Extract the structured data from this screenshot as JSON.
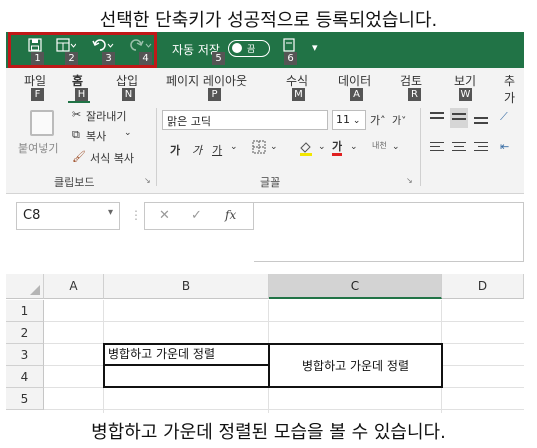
{
  "captions": {
    "top": "선택한 단축키가 성공적으로 등록되었습니다.",
    "bottom": "병합하고 가운데 정렬된 모습을 볼 수 있습니다."
  },
  "qat": {
    "keytips": [
      "1",
      "2",
      "3",
      "4",
      "5",
      "6"
    ],
    "autosave_label": "자동 저장",
    "toggle_label": "끔",
    "icons": [
      "save-icon",
      "merge-center-icon",
      "undo-icon",
      "redo-icon",
      "quick-print-icon",
      "customize-qat-icon"
    ]
  },
  "tabs": [
    {
      "label": "파일",
      "keytip": "F"
    },
    {
      "label": "홈",
      "keytip": "H"
    },
    {
      "label": "삽입",
      "keytip": "N"
    },
    {
      "label": "페이지 레이아웃",
      "keytip": "P"
    },
    {
      "label": "수식",
      "keytip": "M"
    },
    {
      "label": "데이터",
      "keytip": "A"
    },
    {
      "label": "검토",
      "keytip": "R"
    },
    {
      "label": "보기",
      "keytip": "W"
    },
    {
      "label": "추가"
    }
  ],
  "ribbon": {
    "clipboard": {
      "paste": "붙여넣기",
      "cut": "잘라내기",
      "copy": "복사",
      "format_painter": "서식 복사",
      "group_label": "클립보드"
    },
    "font": {
      "font_name": "맑은 고딕",
      "font_size": "11",
      "grow": "가˄",
      "shrink": "가˅",
      "bold": "가",
      "italic": "가",
      "underline": "가",
      "font_color": "가",
      "phonetic": "내천",
      "group_label": "글꼴"
    }
  },
  "formula_bar": {
    "name_box": "C8",
    "cancel": "✕",
    "enter": "✓",
    "fx": "fx",
    "content": ""
  },
  "sheet": {
    "columns": [
      "A",
      "B",
      "C",
      "D"
    ],
    "rows": [
      "1",
      "2",
      "3",
      "4",
      "5"
    ],
    "b3": "병합하고 가운데 정렬",
    "c3_merged": "병합하고 가운데 정렬"
  }
}
